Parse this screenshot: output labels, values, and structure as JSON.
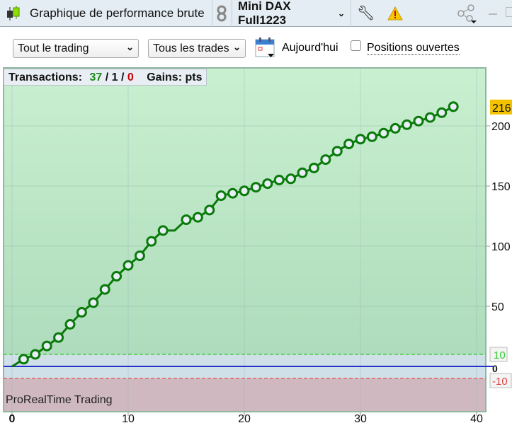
{
  "window": {
    "title": "Graphique de performance brute",
    "instrument": "Mini DAX Full1223",
    "icons": [
      "candlestick-icon",
      "link-icon",
      "wrench-icon",
      "warning-icon",
      "share-icon",
      "minimize-icon",
      "maximize-icon"
    ]
  },
  "toolbar": {
    "period_select": "Tout le trading",
    "trades_select": "Tous les trades",
    "today_label": "Aujourd'hui",
    "open_positions_label": "Positions ouvertes",
    "open_positions_checked": false
  },
  "info": {
    "label": "Transactions:",
    "wins": "37",
    "neutral": "1",
    "losses": "0",
    "gains_label": "Gains: pts"
  },
  "watermark": "ProRealTime Trading",
  "colors": {
    "line": "#0a7a0a",
    "zero_line": "#2233cc",
    "upper_band": "#44cc44",
    "lower_band": "#e06060",
    "last_value_bg": "#f4c300"
  },
  "chart_data": {
    "type": "line",
    "x": [
      0,
      1,
      2,
      3,
      4,
      5,
      6,
      7,
      8,
      9,
      10,
      11,
      12,
      13,
      14,
      15,
      16,
      17,
      18,
      19,
      20,
      21,
      22,
      23,
      24,
      25,
      26,
      27,
      28,
      29,
      30,
      31,
      32,
      33,
      34,
      35,
      36,
      37,
      38
    ],
    "y": [
      0,
      6,
      10,
      17,
      24,
      35,
      45,
      53,
      64,
      75,
      84,
      92,
      104,
      113,
      113,
      122,
      124,
      130,
      142,
      144,
      146,
      149,
      152,
      155,
      156,
      161,
      165,
      172,
      179,
      185,
      189,
      191,
      194,
      198,
      201,
      204,
      207,
      211,
      216
    ],
    "xlim": [
      0,
      40.5
    ],
    "ylim": [
      -45,
      240
    ],
    "xticks": [
      "0",
      "10",
      "20",
      "30",
      "40"
    ],
    "yticks": [
      "50",
      "100",
      "150",
      "200"
    ],
    "last_value": "216",
    "bands": {
      "upper": "10",
      "zero": "0",
      "lower": "-10"
    },
    "grid": true
  }
}
